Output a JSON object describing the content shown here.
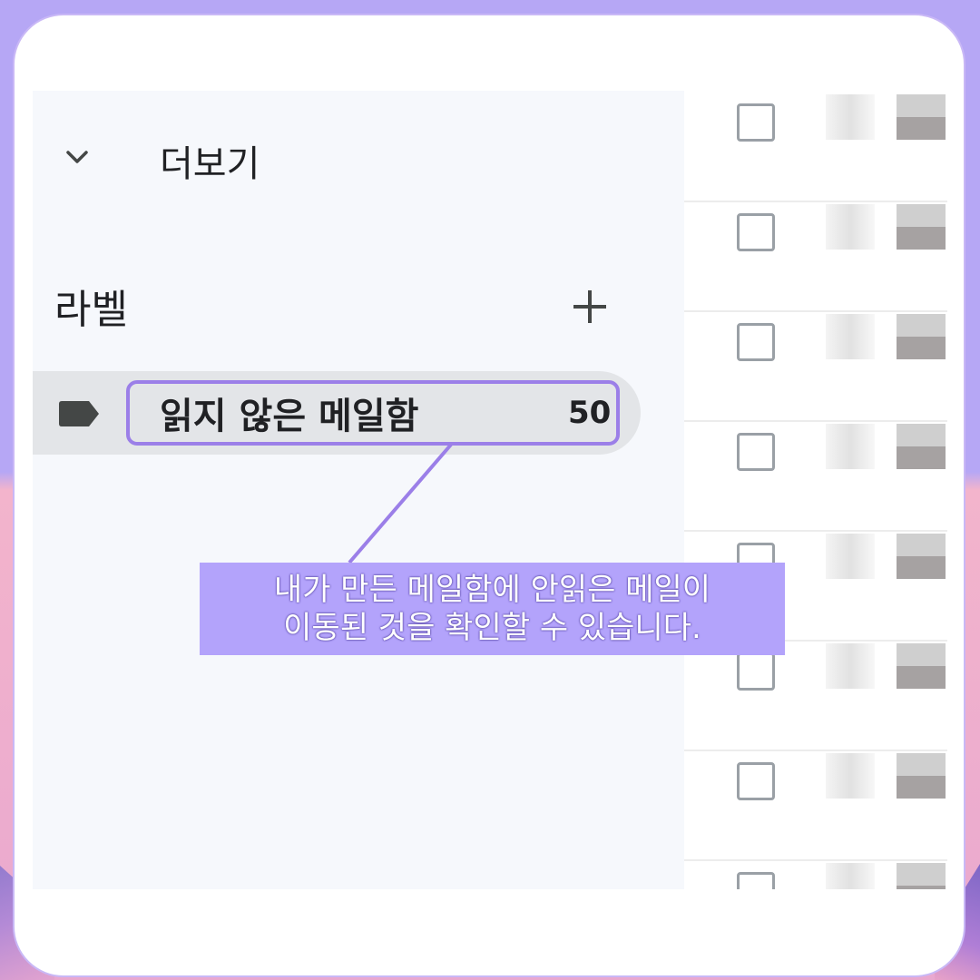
{
  "sidebar": {
    "more_label": "더보기",
    "labels_heading": "라벨",
    "label_items": [
      {
        "name": "읽지 않은 메일함",
        "count": "50"
      }
    ]
  },
  "callout": {
    "line1": "내가 만든 메일함에 안읽은 메일이",
    "line2": "이동된 것을 확인할 수 있습니다."
  },
  "icons": [
    "chevron-down-icon",
    "plus-icon",
    "label-tag-icon",
    "checkbox-icon"
  ],
  "colors": {
    "highlight": "#9b7fe8",
    "callout_bg": "#b3a3fb",
    "sidebar_bg": "#f6f8fc",
    "selected_item_bg": "#e3e5e8"
  }
}
